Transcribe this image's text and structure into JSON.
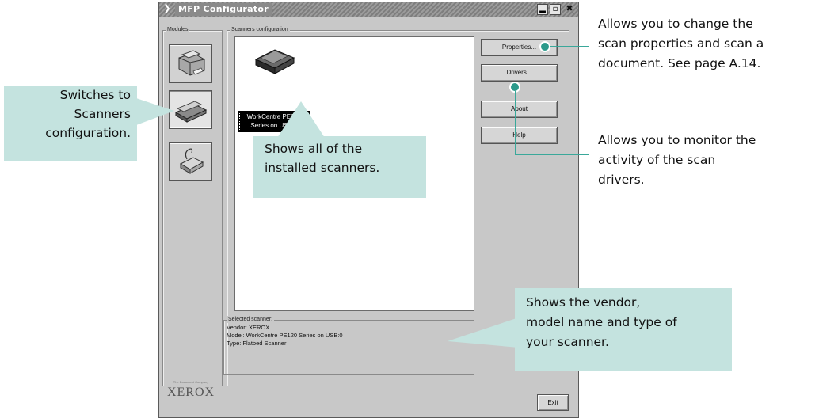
{
  "window": {
    "title": "MFP Configurator",
    "controls": {
      "minimize": "▂",
      "maximize": "▫",
      "close": "✖"
    }
  },
  "modules": {
    "legend": "Modules",
    "items": [
      {
        "name": "printer-module",
        "icon": "printer-icon",
        "active": false
      },
      {
        "name": "scanner-module",
        "icon": "scanner-icon",
        "active": true
      },
      {
        "name": "port-module",
        "icon": "port-icon",
        "active": false
      }
    ],
    "logo_small": "The Document Company",
    "logo": "XEROX"
  },
  "scanners_config": {
    "legend": "Scanners configuration",
    "scanner_label_line1": "WorkCentre PE120",
    "scanner_label_line2": "Series on USB:0",
    "buttons": {
      "properties": "Properties...",
      "drivers": "Drivers...",
      "about": "About",
      "help": "Help"
    },
    "selected": {
      "legend": "Selected scanner:",
      "vendor": "Vendor: XEROX",
      "model": "Model: WorkCentre PE120 Series on USB:0",
      "type": "Type: Flatbed Scanner"
    }
  },
  "exit_label": "Exit",
  "callouts": {
    "switches": {
      "line1": "Switches to",
      "line2": "Scanners",
      "line3": "configuration."
    },
    "installed": {
      "line1": "Shows all of the",
      "line2": "installed scanners."
    },
    "vendor": {
      "line1": "Shows the vendor,",
      "line2": "model name and type of",
      "line3": "your scanner."
    },
    "properties": {
      "line1": "Allows you to change the",
      "line2": "scan properties and scan a",
      "line3": "document. See page A.14."
    },
    "drivers": {
      "line1": "Allows you to monitor the",
      "line2": "activity of the scan",
      "line3": "drivers."
    }
  },
  "colors": {
    "callout_bg": "#c4e3df",
    "callout_line": "#3aa89a",
    "window_bg": "#c8c8c8"
  }
}
